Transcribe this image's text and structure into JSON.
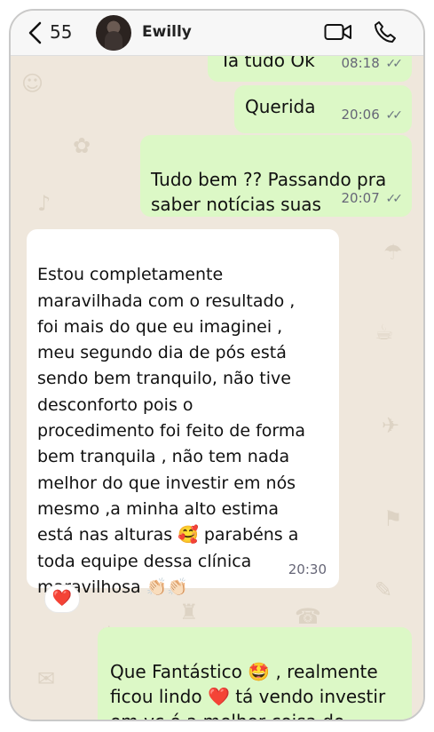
{
  "header": {
    "back_count": "55",
    "contact_name": "Ewilly"
  },
  "messages": [
    {
      "id": "m1",
      "direction": "out",
      "text": "Ta tudo Ok",
      "time": "08:18",
      "status": "read"
    },
    {
      "id": "m2",
      "direction": "out",
      "text": "Querida",
      "time": "20:06",
      "status": "read"
    },
    {
      "id": "m3",
      "direction": "out",
      "text": "Tudo bem ?? Passando pra\nsaber notícias suas",
      "time": "20:07",
      "status": "read"
    },
    {
      "id": "m4",
      "direction": "in",
      "text": "Estou completamente\nmaravilhada com o resultado ,\nfoi mais do que eu imaginei ,\nmeu segundo dia de pós está\nsendo bem tranquilo, não tive\ndesconforto pois o\nprocedimento foi feito de forma\nbem tranquila , não tem nada\nmelhor do que investir em nós\nmesmo ,a minha alto estima\nestá nas alturas 🥰 parabéns a\ntoda equipe dessa clínica\nmaravilhosa 👏🏻👏🏻",
      "time": "20:30",
      "reaction": "❤️"
    },
    {
      "id": "m5",
      "direction": "out",
      "text": "Que Fantástico 🤩 , realmente\nficou lindo ❤️ tá vendo investir\nem vc é a melhor coisa do\nmundo . Que bom que",
      "time": "",
      "status": ""
    }
  ],
  "icons": {
    "back": "chevron-left-icon",
    "video": "video-camera-icon",
    "call": "phone-icon",
    "read_ticks": "double-check-icon"
  },
  "colors": {
    "outgoing_bubble": "#dcf8c6",
    "incoming_bubble": "#ffffff",
    "chat_background": "#efe7dc",
    "read_tick": "#6b7680"
  }
}
